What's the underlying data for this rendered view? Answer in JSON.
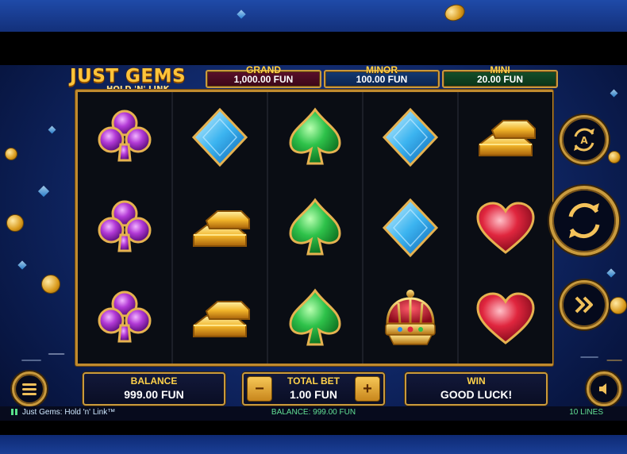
{
  "game": {
    "logo_title": "JUST GEMS",
    "logo_subtitle": "HOLD 'N' LINK"
  },
  "jackpots": [
    {
      "label": "GRAND",
      "value": "1,000.00 FUN",
      "color": "#5a0f2a"
    },
    {
      "label": "MINOR",
      "value": "100.00 FUN",
      "color": "#143a72"
    },
    {
      "label": "MINI",
      "value": "20.00 FUN",
      "color": "#14502a"
    }
  ],
  "reels": {
    "columns": 5,
    "rows": 3,
    "symbols": [
      [
        "purple-club",
        "purple-club",
        "purple-club"
      ],
      [
        "blue-diamond",
        "gold-bars",
        "gold-bars"
      ],
      [
        "green-spade",
        "green-spade",
        "green-spade"
      ],
      [
        "blue-diamond",
        "blue-diamond",
        "red-crown"
      ],
      [
        "gold-bars",
        "red-heart",
        "red-heart"
      ]
    ]
  },
  "controls": {
    "autoplay_icon": "autoplay-icon",
    "spin_icon": "spin-icon",
    "turbo_icon": "fast-forward-icon",
    "menu_icon": "menu-icon",
    "sound_icon": "speaker-icon"
  },
  "bottom": {
    "balance_label": "BALANCE",
    "balance_value": "999.00 FUN",
    "total_bet_label": "TOTAL BET",
    "total_bet_value": "1.00 FUN",
    "minus": "−",
    "plus": "+",
    "win_label": "WIN",
    "win_value": "GOOD LUCK!"
  },
  "status": {
    "game_name": "Just Gems: Hold 'n' Link™",
    "balance_text": "BALANCE: 999.00 FUN",
    "lines_text": "10 LINES"
  },
  "colors": {
    "gold": "#c99a3d",
    "accent_green": "#62e094"
  }
}
